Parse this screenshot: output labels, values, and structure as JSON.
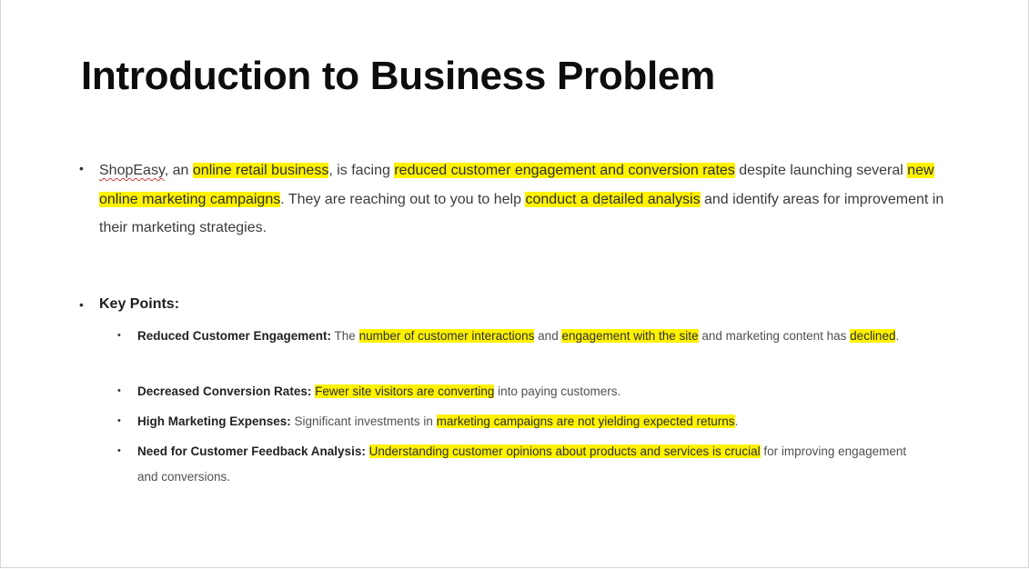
{
  "slide": {
    "title": "Introduction to Business Problem",
    "intro": {
      "company": "ShopEasy",
      "t1": ", an ",
      "h1": "online retail business",
      "t2": ", is facing ",
      "h2": "reduced customer engagement and conversion rates",
      "t3": " despite launching several ",
      "h3": "new online marketing campaigns",
      "t4": ". They are reaching out to you to help ",
      "h4": "conduct a detailed analysis",
      "t5": " and identify areas for improvement in their marketing strategies."
    },
    "key_points_heading": "Key Points:",
    "points": [
      {
        "label": "Reduced Customer Engagement:",
        "t1": " The ",
        "h1": "number of customer interactions",
        "t2": " and ",
        "h2": "engagement with the site",
        "t3": " and marketing content has ",
        "h3": "declined",
        "t4": "."
      },
      {
        "label": "Decreased Conversion Rates:",
        "t1": " ",
        "h1": "Fewer site visitors are converting",
        "t2": " into paying customers."
      },
      {
        "label": "High Marketing Expenses:",
        "t1": " Significant investments in ",
        "h1": "marketing campaigns are not yielding expected returns",
        "t2": "."
      },
      {
        "label": "Need for Customer Feedback Analysis:",
        "t1": " ",
        "h1": "Understanding customer opinions about products and services is crucial",
        "t2": " for improving engagement and conversions."
      }
    ],
    "bullet_glyph": "•",
    "cursor_glyph": "I"
  },
  "colors": {
    "highlight": "#fff200",
    "title": "#0d0d0d",
    "body_text": "#3b3b3b",
    "spellcheck_underline": "#d23b3b"
  }
}
